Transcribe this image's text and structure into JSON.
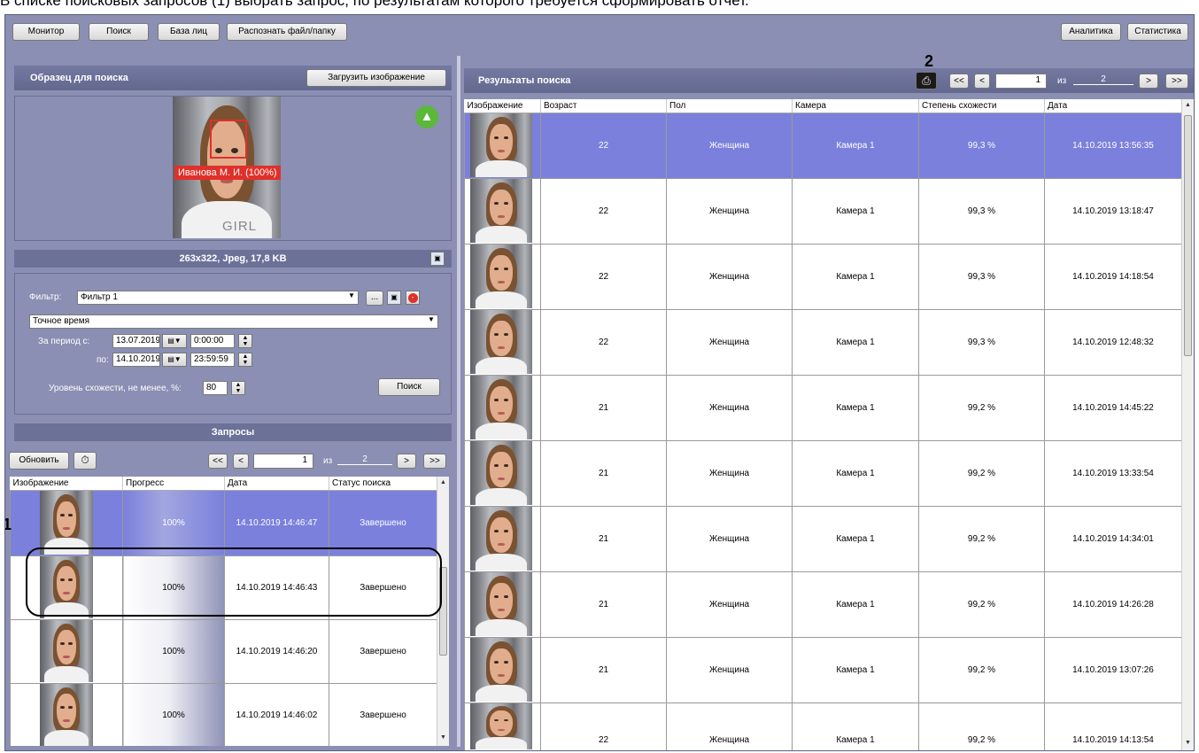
{
  "caption": {
    "text": "В списке поисковых запросов (1) выбрать запрос, по результатам которого требуется сформировать отчет."
  },
  "toolbar": {
    "monitor": "Монитор",
    "search": "Поиск",
    "facebase": "База лиц",
    "recognize": "Распознать файл/папку",
    "analytics": "Аналитика",
    "statistics": "Статистика"
  },
  "sample": {
    "title": "Образец для поиска",
    "load_button": "Загрузить изображение",
    "face_tag": "Иванова М. И. (100%)",
    "shirt_text": "GIRL",
    "info": "263x322, Jpeg, 17,8 KB"
  },
  "filter": {
    "label": "Фильтр:",
    "value": "Фильтр 1",
    "dots": "...",
    "mode": "Точное время",
    "period_from_label": "За период с:",
    "date_from": "13.07.2019",
    "time_from": "0:00:00",
    "period_to_label": "по:",
    "date_to": "14.10.2019",
    "time_to": "23:59:59",
    "similarity_label": "Уровень схожести, не менее, %:",
    "similarity_value": "80",
    "search_button": "Поиск"
  },
  "requests": {
    "title": "Запросы",
    "refresh": "Обновить",
    "pager": {
      "first": "<<",
      "prev": "<",
      "page": "1",
      "of": "из",
      "total": "2",
      "next": ">",
      "last": ">>"
    },
    "columns": [
      "Изображение",
      "Прогресс",
      "Дата",
      "Статус поиска"
    ],
    "rows": [
      {
        "progress": "100%",
        "date": "14.10.2019 14:46:47",
        "status": "Завершено"
      },
      {
        "progress": "100%",
        "date": "14.10.2019 14:46:43",
        "status": "Завершено"
      },
      {
        "progress": "100%",
        "date": "14.10.2019 14:46:20",
        "status": "Завершено"
      },
      {
        "progress": "100%",
        "date": "14.10.2019 14:46:02",
        "status": "Завершено"
      }
    ]
  },
  "results": {
    "title": "Результаты поиска",
    "pager": {
      "first": "<<",
      "prev": "<",
      "page": "1",
      "of": "из",
      "total": "2",
      "next": ">",
      "last": ">>"
    },
    "columns": [
      "Изображение",
      "Возраст",
      "Пол",
      "Камера",
      "Степень схожести",
      "Дата"
    ],
    "rows": [
      {
        "age": "22",
        "gender": "Женщина",
        "camera": "Камера 1",
        "similarity": "99,3 %",
        "date": "14.10.2019 13:56:35"
      },
      {
        "age": "22",
        "gender": "Женщина",
        "camera": "Камера 1",
        "similarity": "99,3 %",
        "date": "14.10.2019 13:18:47"
      },
      {
        "age": "22",
        "gender": "Женщина",
        "camera": "Камера 1",
        "similarity": "99,3 %",
        "date": "14.10.2019 14:18:54"
      },
      {
        "age": "22",
        "gender": "Женщина",
        "camera": "Камера 1",
        "similarity": "99,3 %",
        "date": "14.10.2019 12:48:32"
      },
      {
        "age": "21",
        "gender": "Женщина",
        "camera": "Камера 1",
        "similarity": "99,2 %",
        "date": "14.10.2019 14:45:22"
      },
      {
        "age": "21",
        "gender": "Женщина",
        "camera": "Камера 1",
        "similarity": "99,2 %",
        "date": "14.10.2019 13:33:54"
      },
      {
        "age": "21",
        "gender": "Женщина",
        "camera": "Камера 1",
        "similarity": "99,2 %",
        "date": "14.10.2019 14:34:01"
      },
      {
        "age": "21",
        "gender": "Женщина",
        "camera": "Камера 1",
        "similarity": "99,2 %",
        "date": "14.10.2019 14:26:28"
      },
      {
        "age": "21",
        "gender": "Женщина",
        "camera": "Камера 1",
        "similarity": "99,2 %",
        "date": "14.10.2019 13:07:26"
      },
      {
        "age": "22",
        "gender": "Женщина",
        "camera": "Камера 1",
        "similarity": "99,2 %",
        "date": "14.10.2019 14:13:54"
      }
    ]
  },
  "annotations": {
    "one": "1",
    "two": "2"
  },
  "colors": {
    "app_bg": "#8a8fb3",
    "selected_row": "#7b80dc",
    "header_bar": "#6c7198",
    "like_badge": "#5cb83a",
    "tag_red": "#e0302a"
  },
  "icons": {
    "like": "thumbs-up-icon",
    "save": "floppy-icon",
    "delete": "minus-circle-icon",
    "timer": "stopwatch-icon",
    "print": "printer-icon",
    "calendar": "calendar-icon",
    "spin": "spin-updown-icon",
    "dropdown": "chevron-down-icon"
  }
}
